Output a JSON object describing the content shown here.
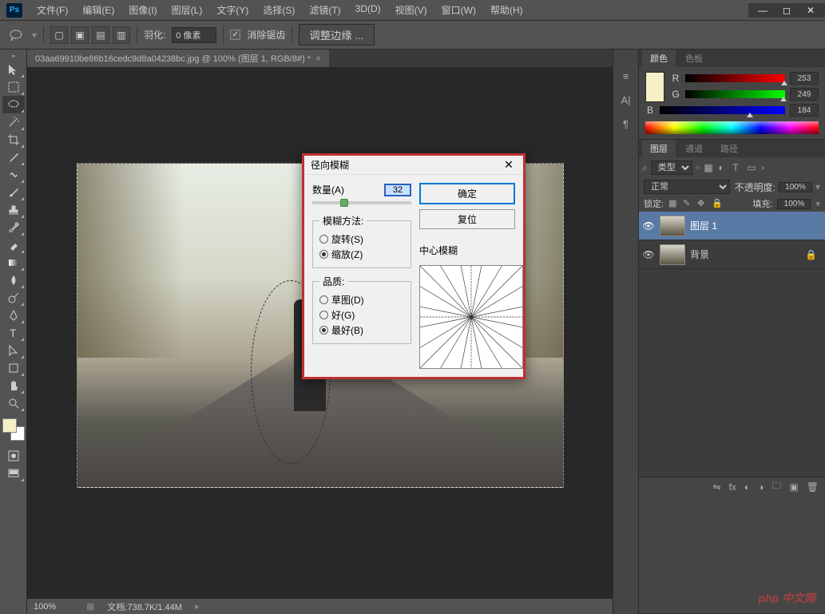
{
  "app": {
    "name": "Ps"
  },
  "menu": [
    "文件(F)",
    "编辑(E)",
    "图像(I)",
    "图层(L)",
    "文字(Y)",
    "选择(S)",
    "滤镜(T)",
    "3D(D)",
    "视图(V)",
    "窗口(W)",
    "帮助(H)"
  ],
  "options": {
    "feather_label": "羽化:",
    "feather_value": "0 像素",
    "antialias": "消除锯齿",
    "refine_edge": "调整边缘 ..."
  },
  "doc_tab": {
    "title": "03aa69910be86b16cedc9d8a04238bc.jpg @ 100% (图层 1, RGB/8#) *"
  },
  "status": {
    "zoom": "100%",
    "doc_info": "文档:738.7K/1.44M"
  },
  "color_panel": {
    "tabs": [
      "颜色",
      "色板"
    ],
    "r": {
      "label": "R",
      "value": "253",
      "pct": 99
    },
    "g": {
      "label": "G",
      "value": "249",
      "pct": 98
    },
    "b": {
      "label": "B",
      "value": "184",
      "pct": 72
    }
  },
  "layers_panel": {
    "tabs": [
      "图层",
      "通道",
      "路径"
    ],
    "filter_label": "类型",
    "blend_mode": "正常",
    "opacity_label": "不透明度:",
    "opacity_value": "100%",
    "lock_label": "锁定:",
    "fill_label": "填充:",
    "fill_value": "100%",
    "layers": [
      {
        "name": "图层 1",
        "visible": true,
        "active": true,
        "locked": false
      },
      {
        "name": "背景",
        "visible": true,
        "active": false,
        "locked": true
      }
    ]
  },
  "dialog": {
    "title": "径向模糊",
    "ok": "确定",
    "reset": "复位",
    "amount_label": "数量(A)",
    "amount_value": "32",
    "amount_pct": 32,
    "method_legend": "模糊方法:",
    "method_spin": "旋转(S)",
    "method_zoom": "缩放(Z)",
    "quality_legend": "品质:",
    "quality_draft": "草图(D)",
    "quality_good": "好(G)",
    "quality_best": "最好(B)",
    "center_label": "中心模糊"
  },
  "watermark": "php 中文网"
}
